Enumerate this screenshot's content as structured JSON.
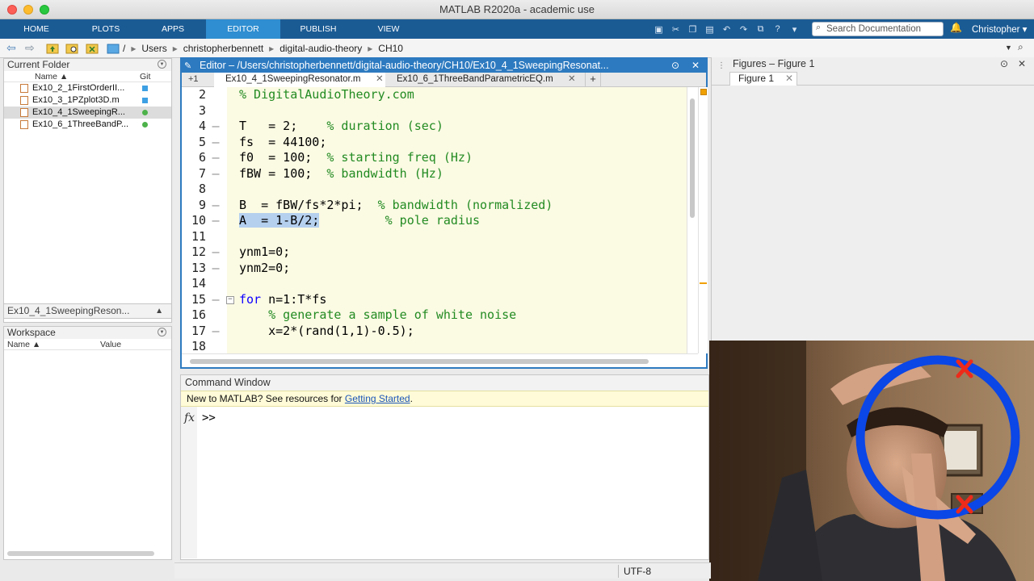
{
  "window": {
    "title": "MATLAB R2020a - academic use"
  },
  "toolstrip": {
    "tabs": [
      {
        "label": "HOME"
      },
      {
        "label": "PLOTS"
      },
      {
        "label": "APPS"
      },
      {
        "label": "EDITOR",
        "active": true
      },
      {
        "label": "PUBLISH"
      },
      {
        "label": "VIEW"
      }
    ],
    "search_placeholder": "Search Documentation",
    "user": "Christopher",
    "accent": "#1b5b94"
  },
  "address": {
    "segments": [
      "/",
      "Users",
      "christopherbennett",
      "digital-audio-theory",
      "CH10"
    ]
  },
  "current_folder": {
    "title": "Current Folder",
    "col_name": "Name ▲",
    "col_git": "Git",
    "files": [
      {
        "name": "Ex10_2_1FirstOrderII...",
        "git": "square"
      },
      {
        "name": "Ex10_3_1PZplot3D.m",
        "git": "square"
      },
      {
        "name": "Ex10_4_1SweepingR...",
        "git": "circle",
        "selected": true
      },
      {
        "name": "Ex10_6_1ThreeBandP...",
        "git": "circle"
      }
    ],
    "details": "Ex10_4_1SweepingReson..."
  },
  "workspace": {
    "title": "Workspace",
    "col_name": "Name ▲",
    "col_value": "Value"
  },
  "editor": {
    "title": "Editor – /Users/christopherbennett/digital-audio-theory/CH10/Ex10_4_1SweepingResonat...",
    "edit_count": "+1",
    "tabs": [
      {
        "label": "Ex10_4_1SweepingResonator.m",
        "active": true
      },
      {
        "label": "Ex10_6_1ThreeBandParametricEQ.m"
      }
    ],
    "lines": [
      {
        "n": "2",
        "code": "",
        "comment": "% DigitalAudioTheory.com",
        "exec": false
      },
      {
        "n": "3",
        "code": "",
        "comment": "",
        "exec": false
      },
      {
        "n": "4",
        "code": "T   = 2;    ",
        "comment": "% duration (sec)",
        "exec": true
      },
      {
        "n": "5",
        "code": "fs  = 44100;",
        "comment": "",
        "exec": true
      },
      {
        "n": "6",
        "code": "f0  = 100;  ",
        "comment": "% starting freq (Hz)",
        "exec": true
      },
      {
        "n": "7",
        "code": "fBW = 100;  ",
        "comment": "% bandwidth (Hz)",
        "exec": true
      },
      {
        "n": "8",
        "code": "",
        "comment": "",
        "exec": false
      },
      {
        "n": "9",
        "code": "B  = fBW/fs*2*pi;  ",
        "comment": "% bandwidth (normalized)",
        "exec": true
      },
      {
        "n": "10",
        "code": "A  = 1-B/2;",
        "trail": "         ",
        "comment": "% pole radius",
        "exec": true,
        "highlight": true
      },
      {
        "n": "11",
        "code": "",
        "comment": "",
        "exec": false
      },
      {
        "n": "12",
        "code": "ynm1=0;",
        "comment": "",
        "exec": true
      },
      {
        "n": "13",
        "code": "ynm2=0;",
        "comment": "",
        "exec": true
      },
      {
        "n": "14",
        "code": "",
        "comment": "",
        "exec": false
      },
      {
        "n": "15",
        "keyword": "for",
        "code": " n=1:T*fs",
        "comment": "",
        "exec": true,
        "fold": true
      },
      {
        "n": "16",
        "code": "    ",
        "comment": "% generate a sample of white noise",
        "exec": false
      },
      {
        "n": "17",
        "code": "    x=2*(rand(1,1)-0.5);",
        "comment": "",
        "exec": true
      },
      {
        "n": "18",
        "code": "",
        "comment": "",
        "exec": false
      }
    ]
  },
  "command_window": {
    "title": "Command Window",
    "banner_text": "New to MATLAB? See resources for ",
    "banner_link": "Getting Started",
    "banner_end": ".",
    "fx": "fx",
    "prompt": ">>"
  },
  "figures": {
    "title": "Figures – Figure 1",
    "tab": "Figure 1"
  },
  "status": {
    "encoding": "UTF-8"
  }
}
